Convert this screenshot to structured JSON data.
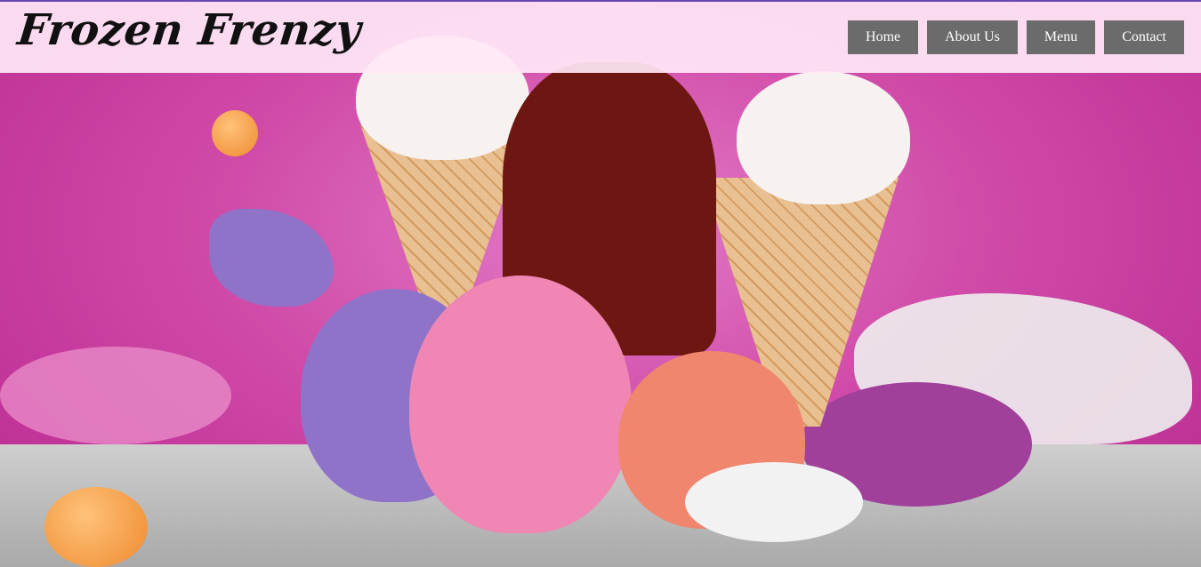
{
  "brand": {
    "logo_text": "Frozen Frenzy"
  },
  "nav": {
    "items": [
      {
        "label": "Home"
      },
      {
        "label": "About Us"
      },
      {
        "label": "Menu"
      },
      {
        "label": "Contact"
      }
    ]
  },
  "hero": {
    "image": "melting-ice-cream-cones-splash"
  },
  "colors": {
    "accent_border": "#6a46b0",
    "nav_button": "#6b6b6b",
    "header_bg": "#ffe8f6"
  }
}
